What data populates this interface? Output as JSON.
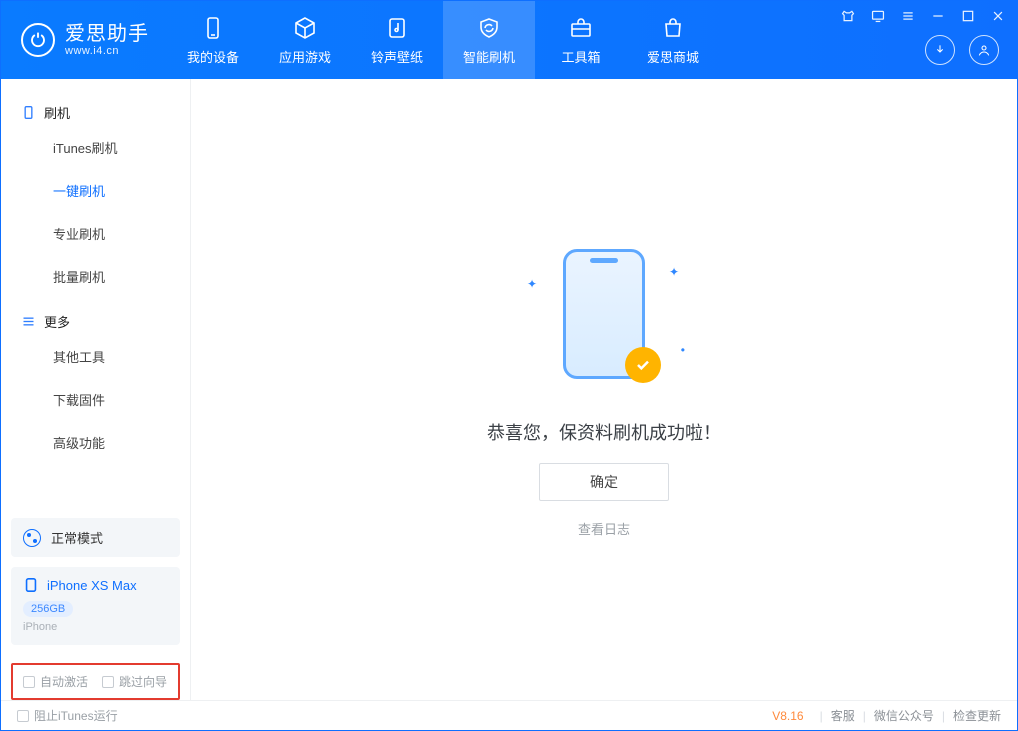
{
  "app": {
    "name_cn": "爱思助手",
    "url": "www.i4.cn"
  },
  "nav": {
    "items": [
      {
        "label": "我的设备"
      },
      {
        "label": "应用游戏"
      },
      {
        "label": "铃声壁纸"
      },
      {
        "label": "智能刷机"
      },
      {
        "label": "工具箱"
      },
      {
        "label": "爱思商城"
      }
    ],
    "active_index": 3
  },
  "sidebar": {
    "groups": [
      {
        "title": "刷机",
        "items": [
          "iTunes刷机",
          "一键刷机",
          "专业刷机",
          "批量刷机"
        ],
        "active_index": 1
      },
      {
        "title": "更多",
        "items": [
          "其他工具",
          "下载固件",
          "高级功能"
        ]
      }
    ],
    "mode": "正常模式",
    "device": {
      "name": "iPhone XS Max",
      "capacity": "256GB",
      "sub": "iPhone"
    },
    "checkboxes": [
      {
        "label": "自动激活",
        "checked": false
      },
      {
        "label": "跳过向导",
        "checked": false
      }
    ]
  },
  "main": {
    "success_msg": "恭喜您，保资料刷机成功啦！",
    "ok_button": "确定",
    "log_link": "查看日志"
  },
  "footer": {
    "prevent_itunes": "阻止iTunes运行",
    "version": "V8.16",
    "links": [
      "客服",
      "微信公众号",
      "检查更新"
    ]
  }
}
